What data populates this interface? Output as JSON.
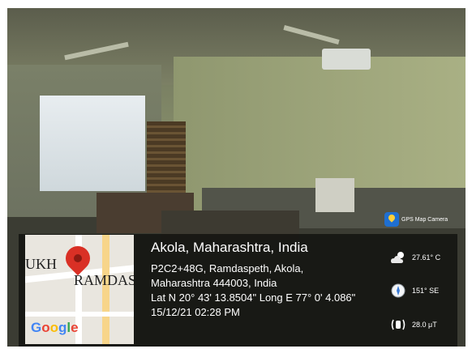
{
  "badge": {
    "icon": "gps-map-camera-icon",
    "label": "GPS Map Camera"
  },
  "map": {
    "labels": [
      "UKH",
      "RAMDAS"
    ],
    "logo": "Google",
    "pin_icon": "map-pin-icon"
  },
  "location": {
    "title": "Akola, Maharashtra, India",
    "lines": [
      "P2C2+48G, Ramdaspeth, Akola,",
      "Maharashtra 444003, India",
      "Lat N 20° 43' 13.8504\" Long E 77° 0' 4.086\"",
      "15/12/21 02:28 PM"
    ]
  },
  "metrics": [
    {
      "icon": "weather-cloud-sun-icon",
      "value": "27.61° C"
    },
    {
      "icon": "compass-icon",
      "value": "151° SE"
    },
    {
      "icon": "magnetic-field-icon",
      "value": "28.0 μT"
    }
  ]
}
